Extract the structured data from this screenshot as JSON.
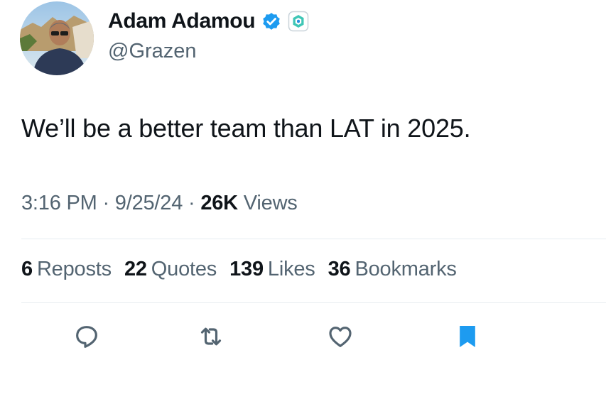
{
  "author": {
    "display_name": "Adam Adamou",
    "handle": "@Grazen",
    "verified_icon": "verified-badge-icon",
    "affiliate_icon": "affiliate-badge-icon"
  },
  "tweet": {
    "text": "We’ll be a better team than LAT in 2025."
  },
  "meta": {
    "time": "3:16 PM",
    "separator1": " · ",
    "date": "9/25/24",
    "separator2": " · ",
    "views_count": "26K",
    "views_label": " Views"
  },
  "stats": {
    "reposts_count": "6",
    "reposts_label": "Reposts",
    "quotes_count": "22",
    "quotes_label": "Quotes",
    "likes_count": "139",
    "likes_label": "Likes",
    "bookmarks_count": "36",
    "bookmarks_label": "Bookmarks"
  },
  "actions": {
    "reply_icon": "reply-icon",
    "repost_icon": "repost-icon",
    "like_icon": "heart-icon",
    "bookmark_icon": "bookmark-icon"
  },
  "colors": {
    "verified_blue": "#1d9bf0",
    "bookmark_blue": "#1d9bf0",
    "secondary_text": "#536471",
    "primary_text": "#0f1419",
    "divider": "#e6ecf0"
  }
}
